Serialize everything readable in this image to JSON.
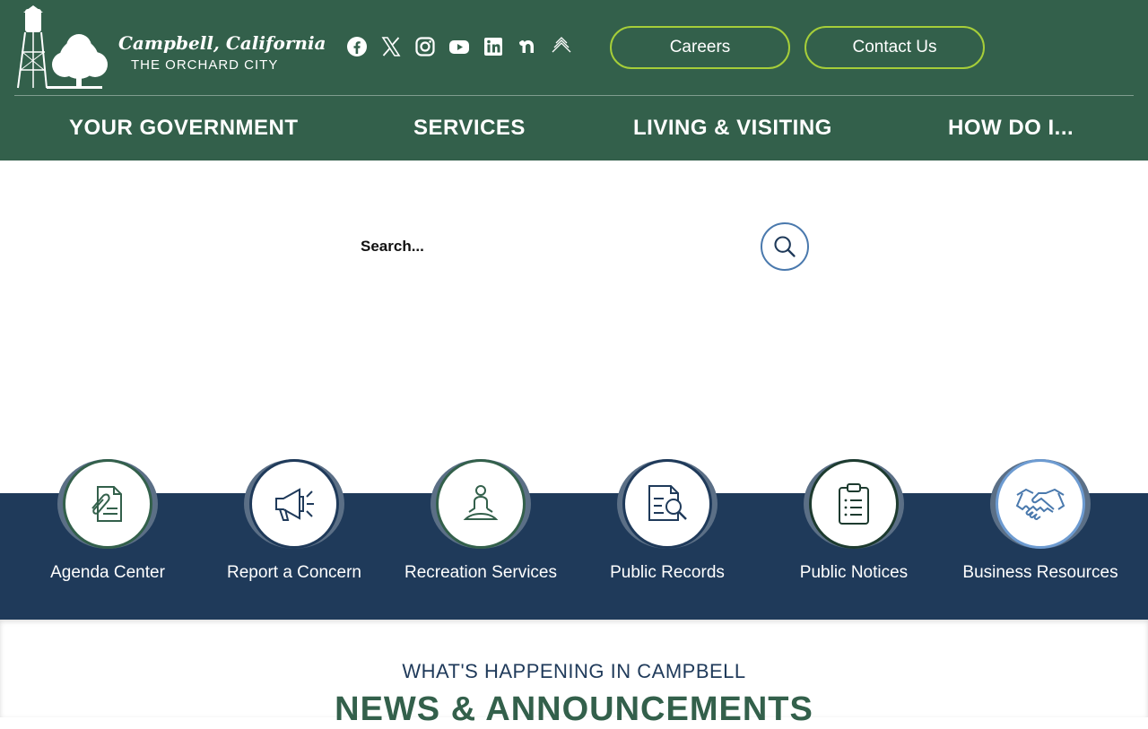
{
  "header": {
    "logo_title": "Campbell, California",
    "logo_subtitle": "THE ORCHARD CITY",
    "social": [
      "facebook-icon",
      "x-icon",
      "instagram-icon",
      "youtube-icon",
      "linkedin-icon",
      "nextdoor-icon",
      "notify-icon"
    ],
    "careers_label": "Careers",
    "contact_label": "Contact Us",
    "colors": {
      "header_bg": "#33604b",
      "pill_border": "#a6ce39"
    }
  },
  "nav": {
    "items": [
      {
        "label": "YOUR GOVERNMENT"
      },
      {
        "label": "SERVICES"
      },
      {
        "label": "LIVING & VISITING"
      },
      {
        "label": "HOW DO I..."
      }
    ]
  },
  "search": {
    "placeholder": "Search...",
    "button_icon": "search-icon"
  },
  "quick_links": {
    "band_color": "#1f3a5a",
    "items": [
      {
        "label": "Agenda Center",
        "icon": "document-clip-icon"
      },
      {
        "label": "Report a Concern",
        "icon": "megaphone-icon"
      },
      {
        "label": "Recreation Services",
        "icon": "meditation-icon"
      },
      {
        "label": "Public Records",
        "icon": "document-search-icon"
      },
      {
        "label": "Public Notices",
        "icon": "clipboard-list-icon"
      },
      {
        "label": "Business Resources",
        "icon": "handshake-icon"
      }
    ]
  },
  "news": {
    "kicker": "WHAT'S HAPPENING IN CAMPBELL",
    "headline": "NEWS & ANNOUNCEMENTS"
  }
}
